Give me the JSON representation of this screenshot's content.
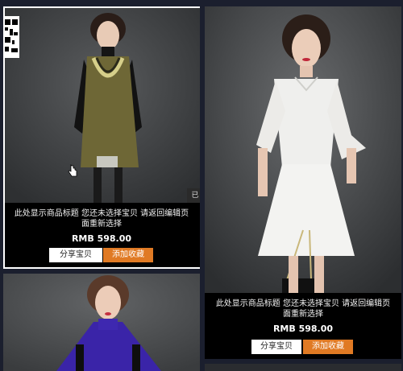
{
  "products": [
    {
      "title": "此处显示商品标题 您还未选择宝贝 请返回编辑页面重新选择",
      "price": "RMB 598.00",
      "share_label": "分享宝贝",
      "favorite_label": "添加收藏",
      "corner_tag": "已"
    },
    {
      "title": "此处显示商品标题 您还未选择宝贝 请返回编辑页面重新选择",
      "price": "RMB 598.00",
      "share_label": "分享宝贝",
      "favorite_label": "添加收藏"
    }
  ],
  "icons": [
    "qr-code-icon",
    "hand-cursor-icon"
  ],
  "colors": {
    "page_bg": "#1b1f2e",
    "info_bg": "#000000",
    "favorite_btn": "#e07a24",
    "share_btn": "#ffffff"
  }
}
